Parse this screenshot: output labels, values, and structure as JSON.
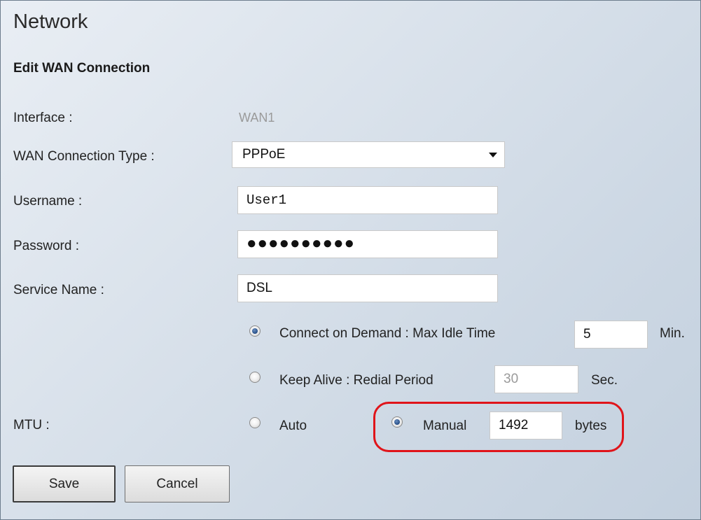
{
  "page": {
    "title": "Network",
    "subtitle": "Edit WAN Connection"
  },
  "form": {
    "interface": {
      "label": "Interface :",
      "value": "WAN1"
    },
    "wan_type": {
      "label": "WAN Connection Type :",
      "value": "PPPoE"
    },
    "username": {
      "label": "Username :",
      "value": "User1"
    },
    "password": {
      "label": "Password :",
      "value": "●●●●●●●●●●"
    },
    "service_name": {
      "label": "Service Name :",
      "value": "DSL"
    },
    "connect_on_demand": {
      "label": "Connect on Demand : Max Idle Time",
      "value": "5",
      "unit": "Min.",
      "selected": true
    },
    "keep_alive": {
      "label": "Keep Alive : Redial Period",
      "value": "30",
      "unit": "Sec.",
      "selected": false
    },
    "mtu": {
      "label": "MTU :",
      "auto_label": "Auto",
      "auto_selected": false,
      "manual_label": "Manual",
      "manual_selected": true,
      "value": "1492",
      "unit": "bytes"
    }
  },
  "buttons": {
    "save": "Save",
    "cancel": "Cancel"
  },
  "colors": {
    "highlight": "#e0141a",
    "radio_selected": "#244d86"
  }
}
